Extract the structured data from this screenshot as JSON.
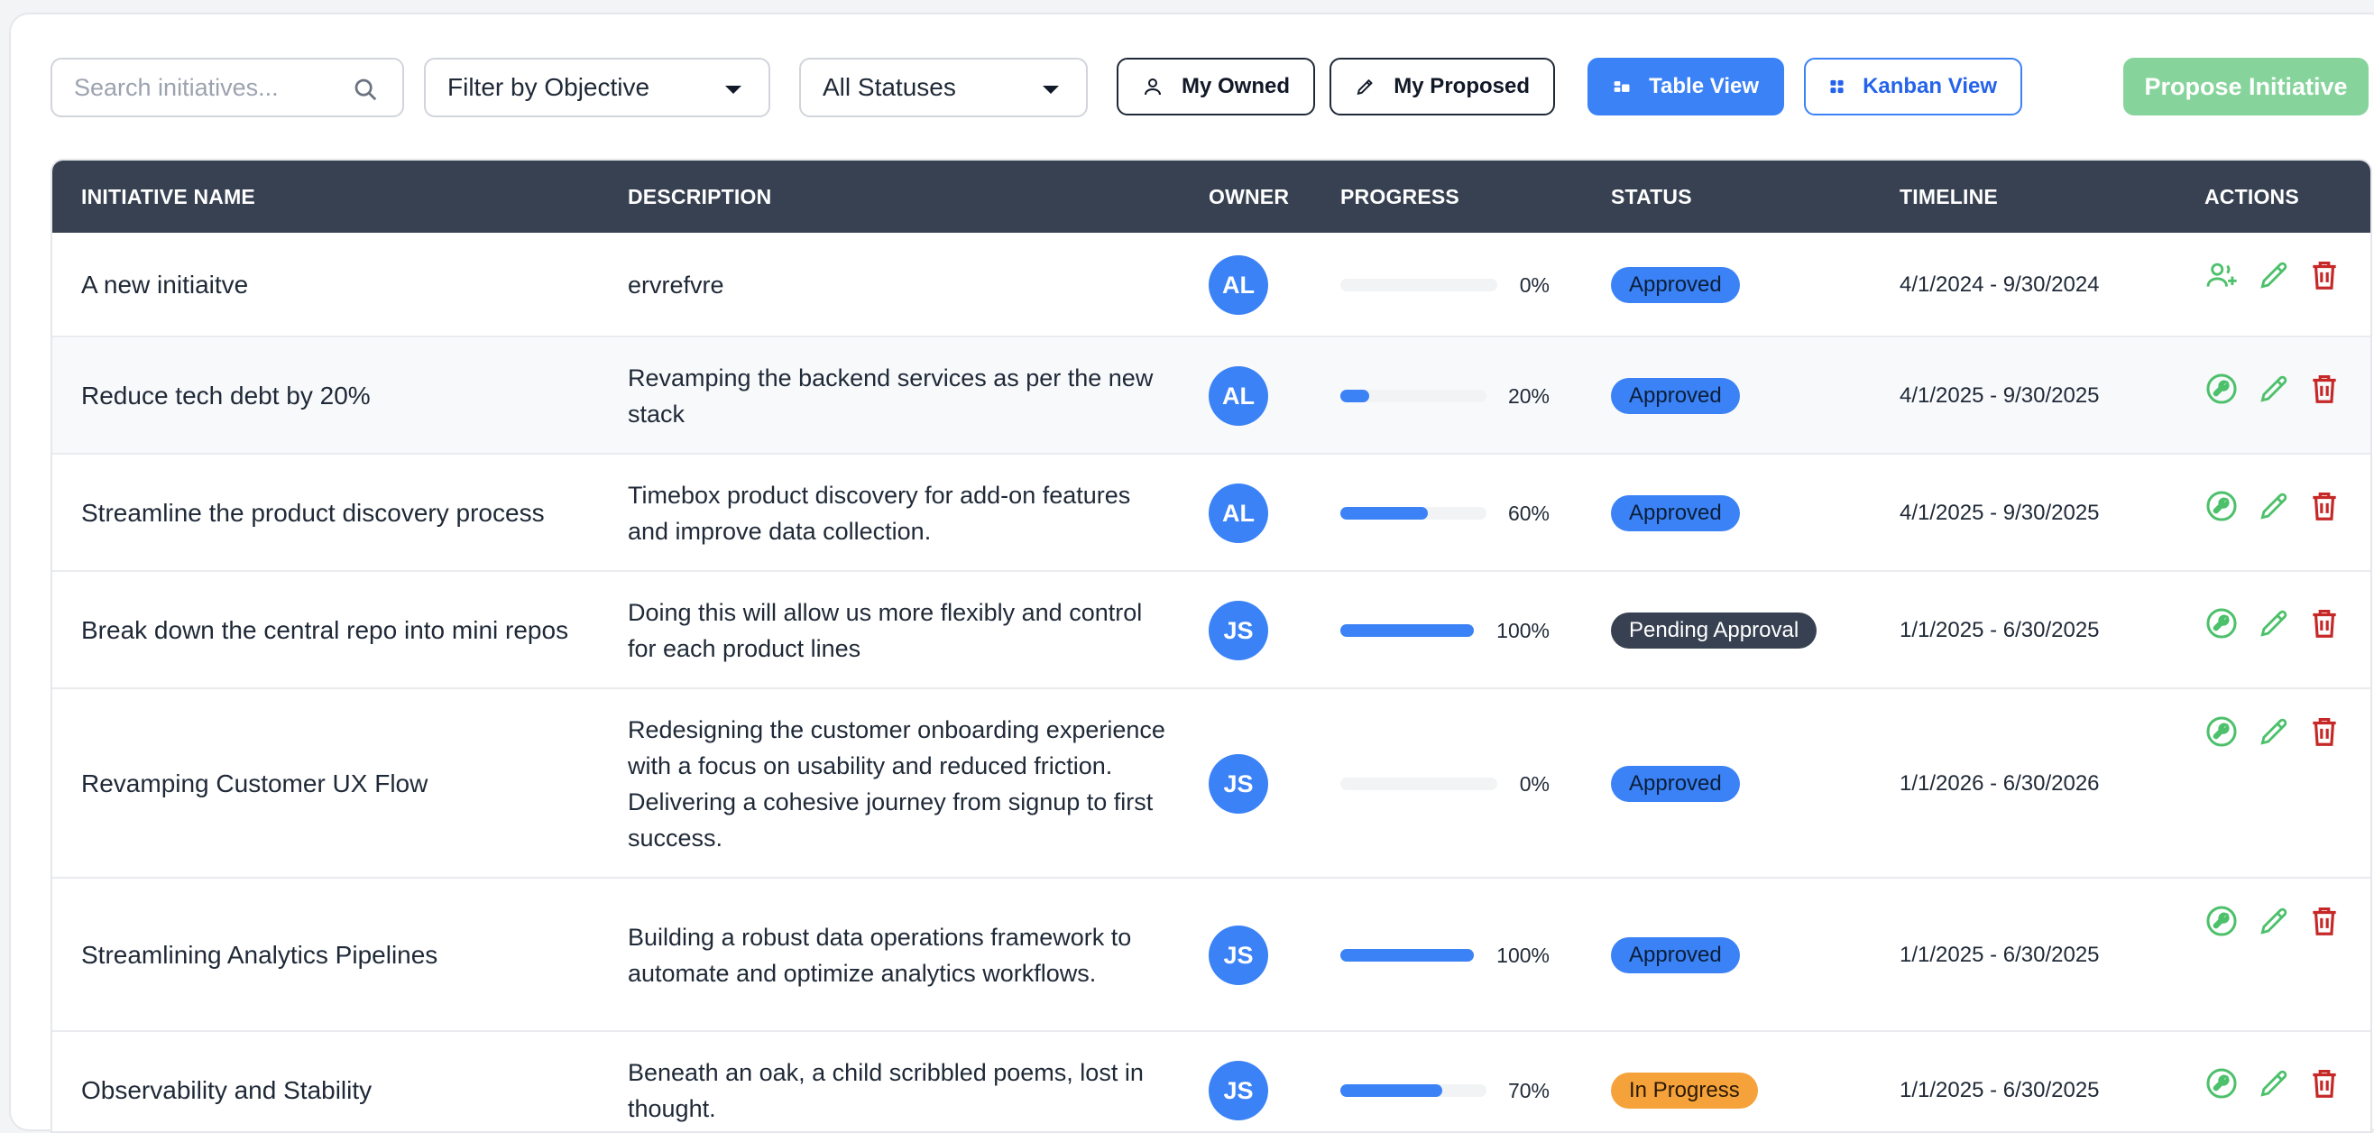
{
  "toolbar": {
    "search_placeholder": "Search initiatives...",
    "filter_objective": "Filter by Objective",
    "filter_status": "All Statuses",
    "my_owned": "My Owned",
    "my_proposed": "My Proposed",
    "table_view": "Table View",
    "kanban_view": "Kanban View",
    "propose": "Propose Initiative"
  },
  "table": {
    "headers": {
      "name": "INITIATIVE NAME",
      "description": "DESCRIPTION",
      "owner": "OWNER",
      "progress": "PROGRESS",
      "status": "STATUS",
      "timeline": "TIMELINE",
      "actions": "ACTIONS"
    },
    "rows": [
      {
        "name": "A new initiaitve",
        "description": "ervrefvre",
        "owner": "AL",
        "progress": 0,
        "progress_label": "0%",
        "status": "Approved",
        "timeline": "4/1/2024 - 9/30/2024",
        "first_action_icon": "assign-user-icon"
      },
      {
        "name": "Reduce tech debt by 20%",
        "description": "Revamping the backend services as per the new stack",
        "owner": "AL",
        "progress": 20,
        "progress_label": "20%",
        "status": "Approved",
        "timeline": "4/1/2025 - 9/30/2025",
        "first_action_icon": "wrench-icon"
      },
      {
        "name": "Streamline the product discovery process",
        "description": "Timebox product discovery for add-on features and improve data collection.",
        "owner": "AL",
        "progress": 60,
        "progress_label": "60%",
        "status": "Approved",
        "timeline": "4/1/2025 - 9/30/2025",
        "first_action_icon": "wrench-icon"
      },
      {
        "name": "Break down the central repo into mini repos",
        "description": "Doing this will allow us more flexibly and control for each product lines",
        "owner": "JS",
        "progress": 100,
        "progress_label": "100%",
        "status": "Pending Approval",
        "timeline": "1/1/2025 - 6/30/2025",
        "first_action_icon": "wrench-icon"
      },
      {
        "name": "Revamping Customer UX Flow",
        "description": "Redesigning the customer onboarding experience with a focus on usability and reduced friction. Delivering a cohesive journey from signup to first success.",
        "owner": "JS",
        "progress": 0,
        "progress_label": "0%",
        "status": "Approved",
        "timeline": "1/1/2026 - 6/30/2026",
        "first_action_icon": "wrench-icon"
      },
      {
        "name": "Streamlining Analytics Pipelines",
        "description": "Building a robust data operations framework to automate and optimize analytics workflows.",
        "owner": "JS",
        "progress": 100,
        "progress_label": "100%",
        "status": "Approved",
        "timeline": "1/1/2025 - 6/30/2025",
        "first_action_icon": "wrench-icon"
      },
      {
        "name": "Observability and Stability",
        "description": "Beneath an oak, a child scribbled poems, lost in thought.",
        "owner": "JS",
        "progress": 70,
        "progress_label": "70%",
        "status": "In Progress",
        "timeline": "1/1/2025 - 6/30/2025",
        "first_action_icon": "wrench-icon"
      }
    ]
  },
  "colors": {
    "header_bg": "#374151",
    "primary": "#3b82f6",
    "action_green": "#4cc06a",
    "action_red": "#c62828",
    "in_progress": "#f6a23b"
  }
}
